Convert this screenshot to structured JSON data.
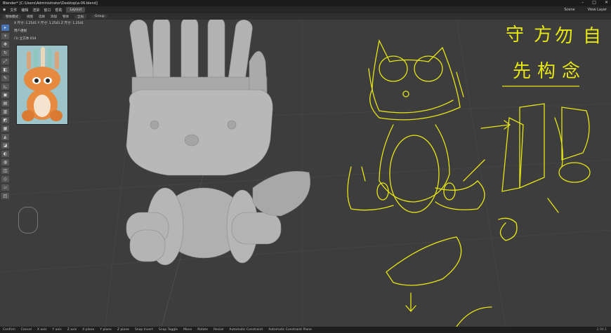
{
  "window": {
    "title": "Blender* [C:\\Users\\Administrator\\Desktop\\a-06.blend]"
  },
  "menu": {
    "items": [
      "文件",
      "编辑",
      "渲染",
      "窗口",
      "帮助"
    ],
    "tabs": [
      "Layout"
    ],
    "right": [
      "Scene",
      "View Layer"
    ]
  },
  "header2": {
    "items": [
      "物体模式",
      "视图",
      "选择",
      "添加",
      "物体"
    ],
    "options": [
      "全局",
      "Group"
    ]
  },
  "viewport_info": {
    "line1": "用户透视",
    "line2": "(1) 立方体.014"
  },
  "dims": "X 尺寸: 1.2541   Y 尺寸: 1.2541   Z 尺寸: 1.2541",
  "status": {
    "items": [
      "Confirm",
      "Cancel",
      "X axis",
      "Y axis",
      "Z axis",
      "X plane",
      "Y plane",
      "Z plane",
      "Snap Invert",
      "Snap Toggle",
      "Move",
      "Rotate",
      "Resize",
      "Automatic Constraint",
      "Automatic Constraint Plane"
    ],
    "version": "2.90.1"
  },
  "handwriting": [
    "守",
    "方",
    "勿",
    "自",
    "先",
    "构",
    "念"
  ],
  "colors": {
    "sketch": "#e6e615",
    "bg": "#3d3d3d",
    "model": "#b5b5b5"
  }
}
